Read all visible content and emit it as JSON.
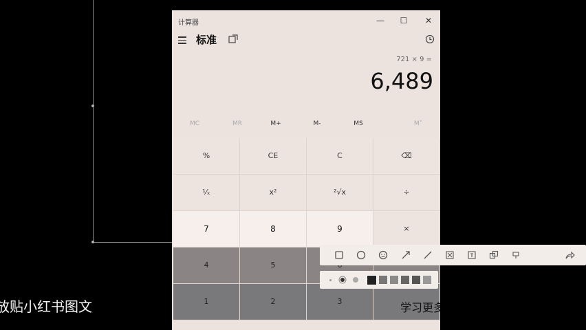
{
  "window": {
    "title": "计算器",
    "controls": {
      "minimize": "—",
      "maximize": "☐",
      "close": "✕"
    }
  },
  "header": {
    "mode": "标准"
  },
  "display": {
    "expression": "721 × 9 =",
    "result": "6,489"
  },
  "memory": [
    "MC",
    "MR",
    "M+",
    "M-",
    "MS",
    "M˅"
  ],
  "keys": [
    [
      "%",
      "CE",
      "C",
      "⌫"
    ],
    [
      "¹⁄ₓ",
      "x²",
      "²√x",
      "÷"
    ],
    [
      "7",
      "8",
      "9",
      "×"
    ],
    [
      "4",
      "5",
      "6",
      ""
    ],
    [
      "1",
      "2",
      "3",
      ""
    ]
  ],
  "snip_toolbar": {
    "tools": [
      "rectangle-icon",
      "circle-icon",
      "emoji-icon",
      "arrow-icon",
      "line-icon",
      "mosaic-icon",
      "text-icon",
      "copy-icon",
      "pin-icon",
      "share-icon"
    ]
  },
  "overlay_text": {
    "left": "放贴小红书图文",
    "right": "学习更多"
  },
  "colors": {
    "calc_bg": "#ece2de",
    "number_key": "#f6efeb",
    "toolbar": "#f3ede9"
  }
}
